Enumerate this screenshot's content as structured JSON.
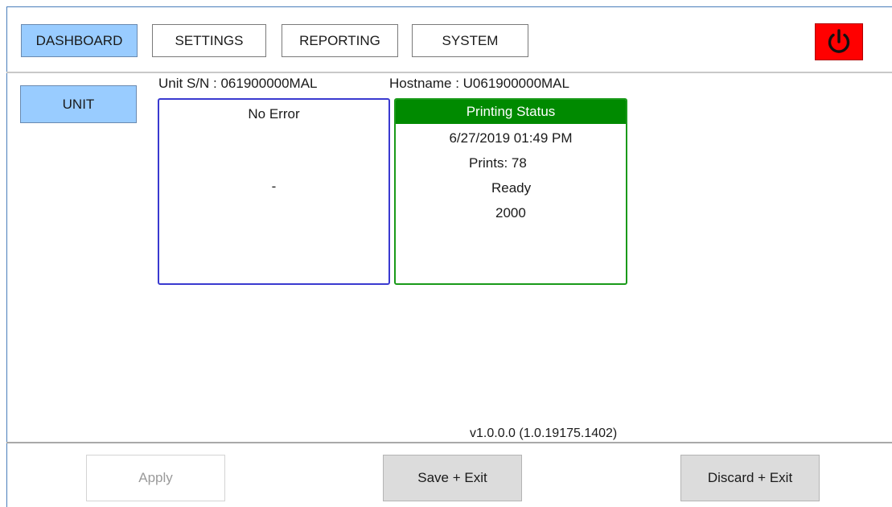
{
  "nav": {
    "tabs": [
      {
        "label": "DASHBOARD",
        "active": true
      },
      {
        "label": "SETTINGS",
        "active": false
      },
      {
        "label": "REPORTING",
        "active": false
      },
      {
        "label": "SYSTEM",
        "active": false
      }
    ],
    "power_icon": "power-icon",
    "power_color": "#ff0000"
  },
  "sidebar": {
    "unit_label": "UNIT"
  },
  "unit": {
    "serial_text": "Unit S/N : 061900000MAL",
    "hostname_text": "Hostname : U061900000MAL"
  },
  "error_panel": {
    "title": "No Error",
    "detail": "-",
    "border_color": "#3a3ad0"
  },
  "status_panel": {
    "title": "Printing Status",
    "datetime": "6/27/2019 01:49 PM",
    "prints": "Prints: 78",
    "state": "Ready",
    "value": "2000",
    "accent_color": "#008a00"
  },
  "footer": {
    "version": "v1.0.0.0 (1.0.19175.1402)",
    "apply_label": "Apply",
    "save_label": "Save + Exit",
    "discard_label": "Discard + Exit"
  }
}
